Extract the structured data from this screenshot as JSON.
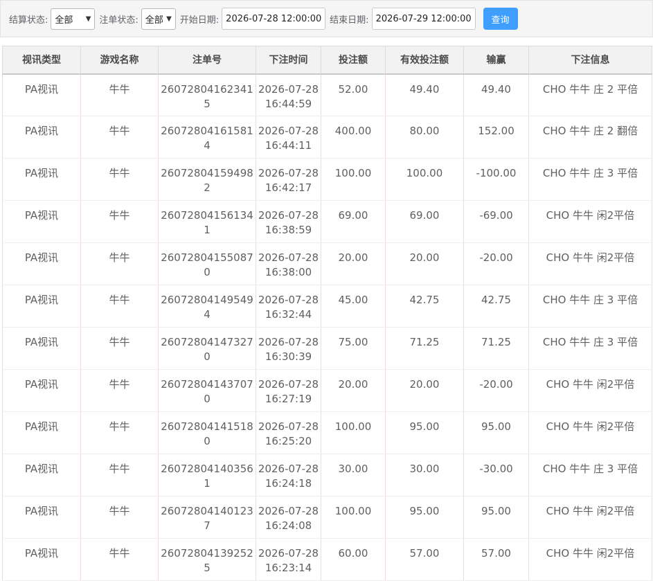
{
  "filters": {
    "settle_label": "结算状态:",
    "settle_value": "全部",
    "order_label": "注单状态:",
    "order_value": "全部",
    "start_label": "开始日期:",
    "start_value": "2026-07-28 12:00:00",
    "end_label": "结束日期:",
    "end_value": "2026-07-29 12:00:00",
    "query_button": "查询"
  },
  "table": {
    "headers": [
      "视讯类型",
      "游戏名称",
      "注单号",
      "下注时间",
      "投注额",
      "有效投注额",
      "输赢",
      "下注信息"
    ],
    "rows": [
      {
        "type": "PA视讯",
        "game": "牛牛",
        "order": "260728041623415",
        "date": "2026-07-28",
        "time": "16:44:59",
        "bet": "52.00",
        "valid": "49.40",
        "win": "49.40",
        "info": "CHO 牛牛 庄 2 平倍"
      },
      {
        "type": "PA视讯",
        "game": "牛牛",
        "order": "260728041615814",
        "date": "2026-07-28",
        "time": "16:44:11",
        "bet": "400.00",
        "valid": "80.00",
        "win": "152.00",
        "info": "CHO 牛牛 庄 2 翻倍"
      },
      {
        "type": "PA视讯",
        "game": "牛牛",
        "order": "260728041594982",
        "date": "2026-07-28",
        "time": "16:42:17",
        "bet": "100.00",
        "valid": "100.00",
        "win": "-100.00",
        "info": "CHO 牛牛 庄 3 平倍"
      },
      {
        "type": "PA视讯",
        "game": "牛牛",
        "order": "260728041561341",
        "date": "2026-07-28",
        "time": "16:38:59",
        "bet": "69.00",
        "valid": "69.00",
        "win": "-69.00",
        "info": "CHO 牛牛 闲2平倍"
      },
      {
        "type": "PA视讯",
        "game": "牛牛",
        "order": "260728041550870",
        "date": "2026-07-28",
        "time": "16:38:00",
        "bet": "20.00",
        "valid": "20.00",
        "win": "-20.00",
        "info": "CHO 牛牛 闲2平倍"
      },
      {
        "type": "PA视讯",
        "game": "牛牛",
        "order": "260728041495494",
        "date": "2026-07-28",
        "time": "16:32:44",
        "bet": "45.00",
        "valid": "42.75",
        "win": "42.75",
        "info": "CHO 牛牛 庄 3 平倍"
      },
      {
        "type": "PA视讯",
        "game": "牛牛",
        "order": "260728041473270",
        "date": "2026-07-28",
        "time": "16:30:39",
        "bet": "75.00",
        "valid": "71.25",
        "win": "71.25",
        "info": "CHO 牛牛 庄 3 平倍"
      },
      {
        "type": "PA视讯",
        "game": "牛牛",
        "order": "260728041437070",
        "date": "2026-07-28",
        "time": "16:27:19",
        "bet": "20.00",
        "valid": "20.00",
        "win": "-20.00",
        "info": "CHO 牛牛 闲2平倍"
      },
      {
        "type": "PA视讯",
        "game": "牛牛",
        "order": "260728041415180",
        "date": "2026-07-28",
        "time": "16:25:20",
        "bet": "100.00",
        "valid": "95.00",
        "win": "95.00",
        "info": "CHO 牛牛 闲2平倍"
      },
      {
        "type": "PA视讯",
        "game": "牛牛",
        "order": "260728041403561",
        "date": "2026-07-28",
        "time": "16:24:18",
        "bet": "30.00",
        "valid": "30.00",
        "win": "-30.00",
        "info": "CHO 牛牛 庄 3 平倍"
      },
      {
        "type": "PA视讯",
        "game": "牛牛",
        "order": "260728041401237",
        "date": "2026-07-28",
        "time": "16:24:08",
        "bet": "100.00",
        "valid": "95.00",
        "win": "95.00",
        "info": "CHO 牛牛 闲2平倍"
      },
      {
        "type": "PA视讯",
        "game": "牛牛",
        "order": "260728041392525",
        "date": "2026-07-28",
        "time": "16:23:14",
        "bet": "60.00",
        "valid": "57.00",
        "win": "57.00",
        "info": "CHO 牛牛 闲2平倍"
      }
    ]
  }
}
